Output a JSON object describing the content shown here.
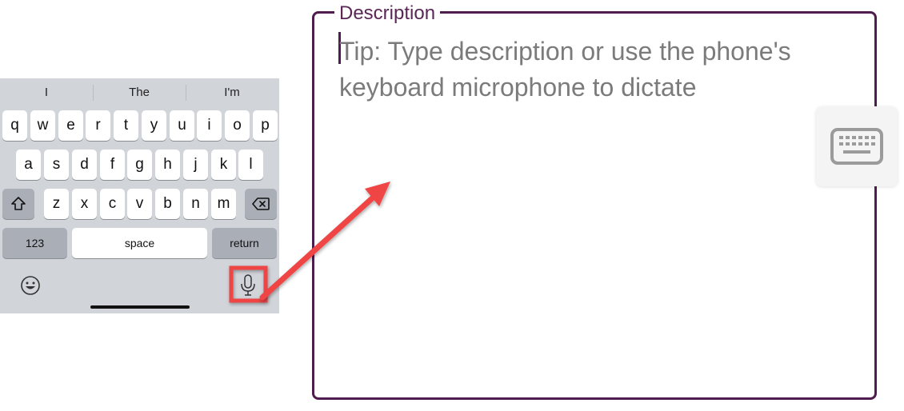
{
  "keyboard": {
    "suggestions": [
      "I",
      "The",
      "I'm"
    ],
    "row1": [
      "q",
      "w",
      "e",
      "r",
      "t",
      "y",
      "u",
      "i",
      "o",
      "p"
    ],
    "row2": [
      "a",
      "s",
      "d",
      "f",
      "g",
      "h",
      "j",
      "k",
      "l"
    ],
    "row3": [
      "z",
      "x",
      "c",
      "v",
      "b",
      "n",
      "m"
    ],
    "numbers_label": "123",
    "space_label": "space",
    "return_label": "return",
    "icons": [
      "shift-icon",
      "backspace-icon",
      "emoji-icon",
      "microphone-icon"
    ]
  },
  "description": {
    "label": "Description",
    "placeholder": "Tip: Type description or use the phone's keyboard microphone to dictate",
    "border_color": "#4f1d4d",
    "dismiss_icon": "keyboard-icon"
  },
  "annotation": {
    "color": "#ef4444",
    "highlight": "microphone-button"
  }
}
